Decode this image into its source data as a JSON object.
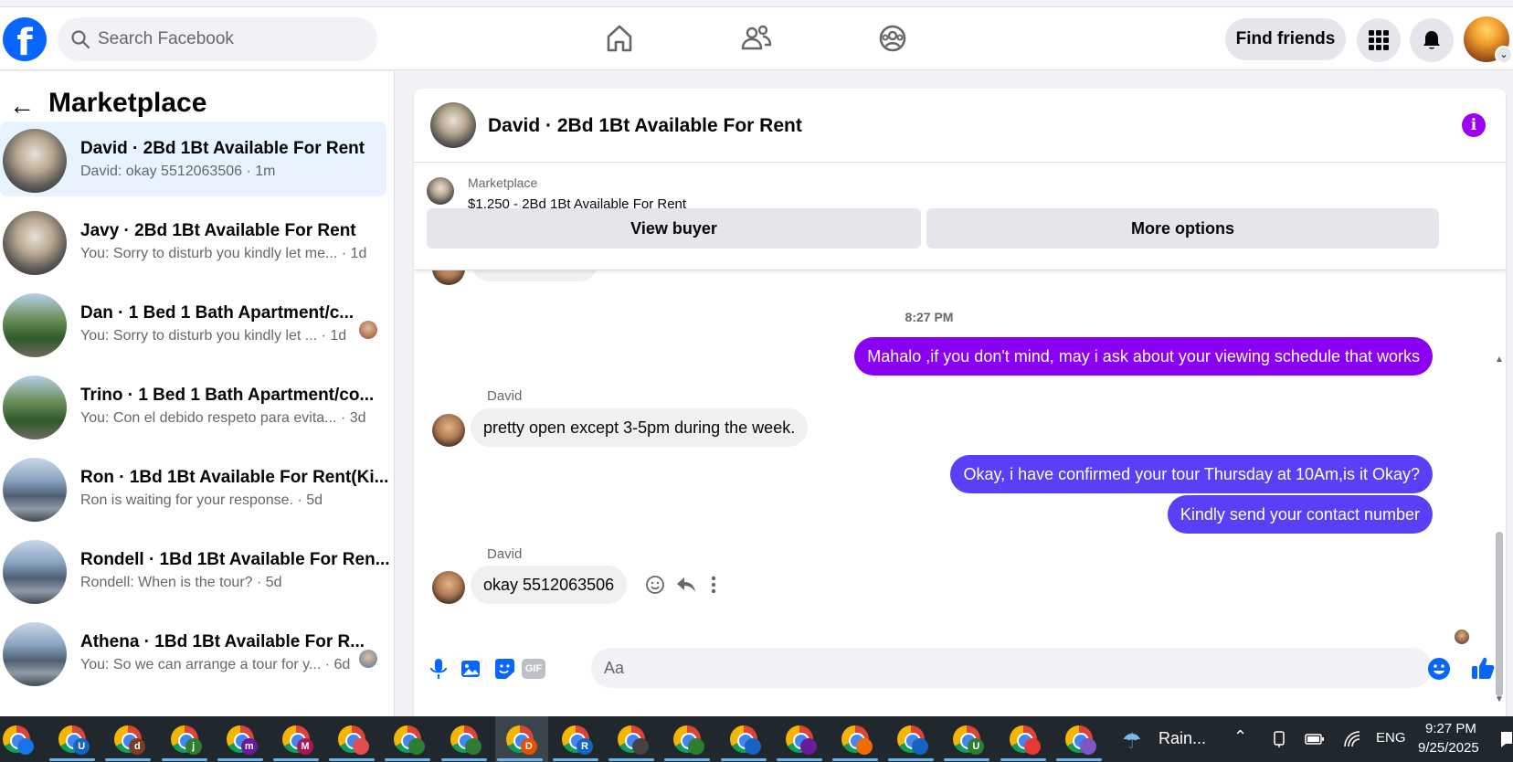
{
  "topbar": {
    "logo_letter": "f",
    "search_placeholder": "Search Facebook",
    "find_friends_label": "Find friends"
  },
  "sidebar": {
    "title": "Marketplace",
    "conversations": [
      {
        "name": "David · 2Bd 1Bt Available For Rent",
        "snippet": "David: okay 5512063506 · 1m",
        "thumb": "interior",
        "active": true
      },
      {
        "name": "Javy · 2Bd 1Bt Available For Rent",
        "snippet": "You: Sorry to disturb you kindly let me... · 1d",
        "thumb": "interior"
      },
      {
        "name": "Dan · 1 Bed 1 Bath Apartment/c...",
        "snippet": "You: Sorry to disturb you kindly let ... · 1d",
        "thumb": "trees"
      },
      {
        "name": "Trino · 1 Bed 1 Bath Apartment/co...",
        "snippet": "You: Con el debido respeto para evita... · 3d",
        "thumb": "trees"
      },
      {
        "name": "Ron · 1Bd 1Bt Available For Rent(Ki...",
        "snippet": "Ron is waiting for your response. · 5d",
        "thumb": "house"
      },
      {
        "name": "Rondell · 1Bd 1Bt Available For Ren...",
        "snippet": "Rondell: When is the tour? · 5d",
        "thumb": "house"
      },
      {
        "name": "Athena · 1Bd 1Bt Available For R...",
        "snippet": "You: So we can arrange a tour for y... · 6d",
        "thumb": "house"
      }
    ]
  },
  "chat": {
    "title": "David · 2Bd 1Bt Available For Rent",
    "listing_source": "Marketplace",
    "listing_title": "$1,250 - 2Bd 1Bt Available For Rent",
    "view_buyer_label": "View buyer",
    "more_options_label": "More options",
    "timestamp": "8:27 PM",
    "messages": [
      {
        "from": "me",
        "text": "Mahalo ,if you don't mind, may i ask about your viewing schedule that works"
      },
      {
        "from": "David",
        "sender_label": "David",
        "text": "pretty open except 3-5pm during the week."
      },
      {
        "from": "me",
        "text": "Okay, i have confirmed your tour Thursday at 10Am,is it Okay?"
      },
      {
        "from": "me",
        "text": "Kindly send your contact number"
      },
      {
        "from": "David",
        "sender_label": "David",
        "text": "okay 5512063506"
      }
    ],
    "composer_placeholder": "Aa",
    "gif_label": "GIF"
  },
  "taskbar": {
    "weather_text": "Rain...",
    "language": "ENG",
    "time": "9:27 PM",
    "date": "9/25/2025",
    "app_badges": [
      "",
      "U",
      "d",
      "j",
      "m",
      "M",
      "",
      "",
      "",
      "D",
      "R",
      "",
      "",
      "",
      "",
      "",
      "",
      "U",
      "",
      ""
    ]
  },
  "colors": {
    "brand_blue": "#0866ff",
    "outgoing_purple": "#8a00f5",
    "outgoing_indigo": "#5740f5",
    "active_row": "#e7f3ff"
  }
}
